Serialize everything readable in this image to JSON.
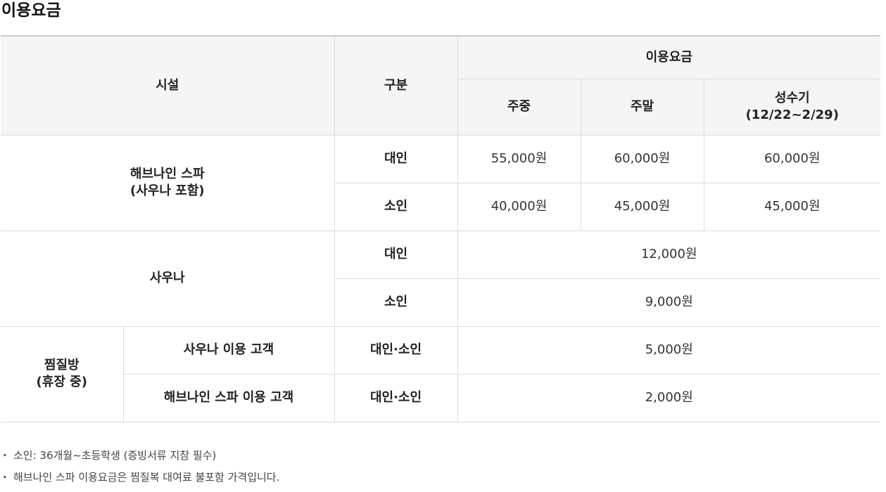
{
  "page": {
    "title": "이용요금"
  },
  "table": {
    "headers": {
      "facility": "시설",
      "category": "구분",
      "fee_group": "이용요금",
      "weekday": "주중",
      "weekend": "주말",
      "peak_season": "성수기",
      "peak_season_period": "(12/22~2/29)"
    },
    "rows": {
      "spa": {
        "name_line1": "해브나인 스파",
        "name_line2": "(사우나 포함)",
        "adult": {
          "label": "대인",
          "weekday": "55,000원",
          "weekend": "60,000원",
          "peak": "60,000원"
        },
        "child": {
          "label": "소인",
          "weekday": "40,000원",
          "weekend": "45,000원",
          "peak": "45,000원"
        }
      },
      "sauna": {
        "name": "사우나",
        "adult": {
          "label": "대인",
          "price": "12,000원"
        },
        "child": {
          "label": "소인",
          "price": "9,000원"
        }
      },
      "jjimjilbang": {
        "name_line1": "찜질방",
        "name_line2": "(휴장 중)",
        "sauna_guest": {
          "label": "사우나 이용 고객",
          "category": "대인·소인",
          "price": "5,000원"
        },
        "spa_guest": {
          "label": "해브나인 스파 이용 고객",
          "category": "대인·소인",
          "price": "2,000원"
        }
      }
    }
  },
  "notes": [
    "소인: 36개월~초등학생 (증빙서류 지참 필수)",
    "해브나인 스파 이용요금은 찜질복 대여료 불포함 가격입니다."
  ],
  "bullet": "·"
}
